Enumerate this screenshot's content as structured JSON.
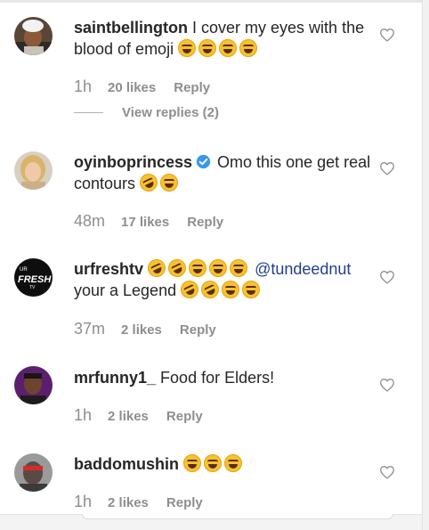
{
  "comments": [
    {
      "username": "saintbellington",
      "text": "I cover my eyes with the blood of emoji",
      "emojis_after": [
        "laugh",
        "laugh",
        "laugh",
        "laugh"
      ],
      "time": "1h",
      "likes": "20 likes",
      "reply": "Reply",
      "view_replies": "View replies (2)"
    },
    {
      "username": "oyinboprincess",
      "verified": true,
      "text": "Omo this one get real contours",
      "emojis_after": [
        "rofl",
        "laugh"
      ],
      "time": "48m",
      "likes": "17 likes",
      "reply": "Reply"
    },
    {
      "username": "urfreshtv",
      "mention": "@tundeednut",
      "text": "your a Legend",
      "emojis_before_mention": [
        "rofl",
        "rofl",
        "laugh",
        "laugh",
        "laugh"
      ],
      "emojis_after": [
        "rofl",
        "rofl",
        "laugh",
        "laugh"
      ],
      "avatar_text": "FRESH",
      "time": "37m",
      "likes": "2 likes",
      "reply": "Reply"
    },
    {
      "username": "mrfunny1_",
      "text": "Food for Elders!",
      "time": "1h",
      "likes": "2 likes",
      "reply": "Reply"
    },
    {
      "username": "baddomushin",
      "text": "",
      "emojis_after": [
        "laugh",
        "laugh",
        "laugh"
      ],
      "time": "1h",
      "likes": "2 likes",
      "reply": "Reply"
    }
  ],
  "colors": {
    "text": "#262626",
    "meta": "#8e8e8e",
    "mention": "#223f8c",
    "verified": "#3897f0",
    "emoji": "#f7c22e"
  },
  "icons": {
    "like": "heart-outline-icon",
    "verified": "verified-badge-icon"
  }
}
